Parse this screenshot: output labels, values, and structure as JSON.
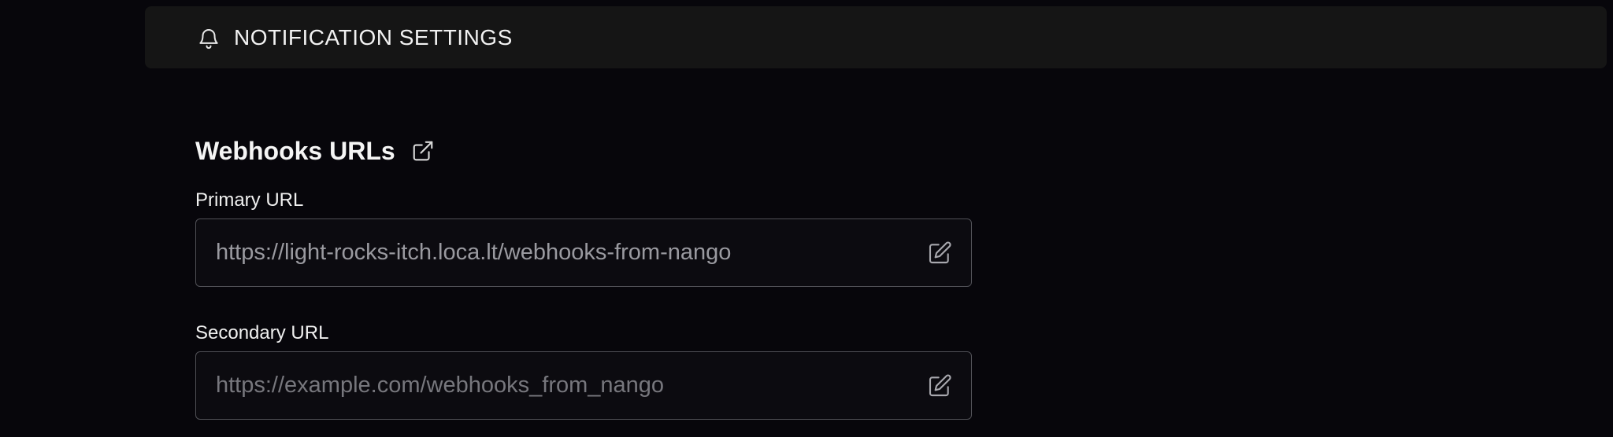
{
  "header": {
    "title": "NOTIFICATION SETTINGS",
    "icon": "bell-icon"
  },
  "webhooks": {
    "heading": "Webhooks URLs",
    "link_icon": "external-link-icon",
    "primary": {
      "label": "Primary URL",
      "value": "https://light-rocks-itch.loca.lt/webhooks-from-nango",
      "edit_icon": "edit-icon"
    },
    "secondary": {
      "label": "Secondary URL",
      "placeholder": "https://example.com/webhooks_from_nango",
      "edit_icon": "edit-icon"
    }
  },
  "colors": {
    "background": "#07060b",
    "header_background": "#151515",
    "field_border": "#505056",
    "text_muted": "#9a9aa0"
  }
}
